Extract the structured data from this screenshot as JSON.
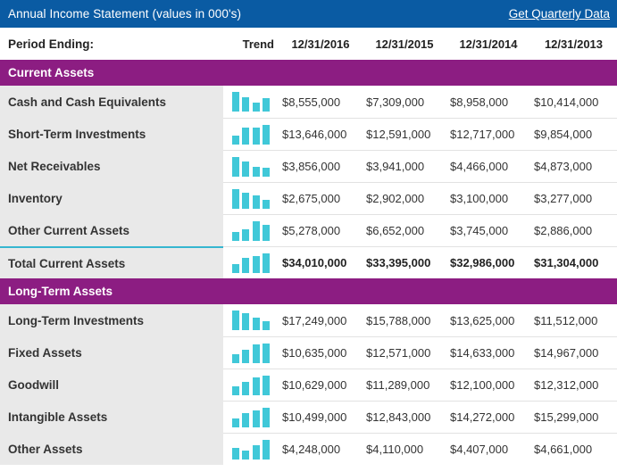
{
  "header": {
    "title": "Annual Income Statement (values in 000's)",
    "link_label": "Get Quarterly Data",
    "bar_color": "#0a5ba3"
  },
  "columns": {
    "period_label": "Period Ending:",
    "trend_label": "Trend",
    "dates": [
      "12/31/2016",
      "12/31/2015",
      "12/31/2014",
      "12/31/2013"
    ]
  },
  "colors": {
    "section_header": "#8c1d82",
    "sparkline_bar": "#40c8d8",
    "total_rule": "#36b6d0",
    "label_column": "#e9e9e9"
  },
  "sections": [
    {
      "title": "Current Assets",
      "rows": [
        {
          "label": "Cash and Cash Equivalents",
          "values": [
            "$8,555,000",
            "$7,309,000",
            "$8,958,000",
            "$10,414,000"
          ],
          "trend": [
            10414,
            8958,
            7309,
            8555
          ],
          "total": false
        },
        {
          "label": "Short-Term Investments",
          "values": [
            "$13,646,000",
            "$12,591,000",
            "$12,717,000",
            "$9,854,000"
          ],
          "trend": [
            9854,
            12717,
            12591,
            13646
          ],
          "total": false
        },
        {
          "label": "Net Receivables",
          "values": [
            "$3,856,000",
            "$3,941,000",
            "$4,466,000",
            "$4,873,000"
          ],
          "trend": [
            4873,
            4466,
            3941,
            3856
          ],
          "total": false
        },
        {
          "label": "Inventory",
          "values": [
            "$2,675,000",
            "$2,902,000",
            "$3,100,000",
            "$3,277,000"
          ],
          "trend": [
            3277,
            3100,
            2902,
            2675
          ],
          "total": false
        },
        {
          "label": "Other Current Assets",
          "values": [
            "$5,278,000",
            "$6,652,000",
            "$3,745,000",
            "$2,886,000"
          ],
          "trend": [
            2886,
            3745,
            6652,
            5278
          ],
          "total": false
        },
        {
          "label": "Total Current Assets",
          "values": [
            "$34,010,000",
            "$33,395,000",
            "$32,986,000",
            "$31,304,000"
          ],
          "trend": [
            31304,
            32986,
            33395,
            34010
          ],
          "total": true
        }
      ]
    },
    {
      "title": "Long-Term Assets",
      "rows": [
        {
          "label": "Long-Term Investments",
          "values": [
            "$17,249,000",
            "$15,788,000",
            "$13,625,000",
            "$11,512,000"
          ],
          "trend": [
            17249,
            15788,
            13625,
            11512
          ],
          "total": false
        },
        {
          "label": "Fixed Assets",
          "values": [
            "$10,635,000",
            "$12,571,000",
            "$14,633,000",
            "$14,967,000"
          ],
          "trend": [
            10635,
            12571,
            14633,
            14967
          ],
          "total": false
        },
        {
          "label": "Goodwill",
          "values": [
            "$10,629,000",
            "$11,289,000",
            "$12,100,000",
            "$12,312,000"
          ],
          "trend": [
            10629,
            11289,
            12100,
            12312
          ],
          "total": false
        },
        {
          "label": "Intangible Assets",
          "values": [
            "$10,499,000",
            "$12,843,000",
            "$14,272,000",
            "$15,299,000"
          ],
          "trend": [
            10499,
            12843,
            14272,
            15299
          ],
          "total": false
        },
        {
          "label": "Other Assets",
          "values": [
            "$4,248,000",
            "$4,110,000",
            "$4,407,000",
            "$4,661,000"
          ],
          "trend": [
            4248,
            4110,
            4407,
            4661
          ],
          "total": false
        }
      ]
    }
  ],
  "chart_data": {
    "type": "table",
    "title": "Annual Income Statement (values in 000's)",
    "categories": [
      "12/31/2016",
      "12/31/2015",
      "12/31/2014",
      "12/31/2013"
    ],
    "series": [
      {
        "name": "Cash and Cash Equivalents",
        "values": [
          8555000,
          7309000,
          8958000,
          10414000
        ]
      },
      {
        "name": "Short-Term Investments",
        "values": [
          13646000,
          12591000,
          12717000,
          9854000
        ]
      },
      {
        "name": "Net Receivables",
        "values": [
          3856000,
          3941000,
          4466000,
          4873000
        ]
      },
      {
        "name": "Inventory",
        "values": [
          2675000,
          2902000,
          3100000,
          3277000
        ]
      },
      {
        "name": "Other Current Assets",
        "values": [
          5278000,
          6652000,
          3745000,
          2886000
        ]
      },
      {
        "name": "Total Current Assets",
        "values": [
          34010000,
          33395000,
          32986000,
          31304000
        ]
      },
      {
        "name": "Long-Term Investments",
        "values": [
          17249000,
          15788000,
          13625000,
          11512000
        ]
      },
      {
        "name": "Fixed Assets",
        "values": [
          10635000,
          12571000,
          14633000,
          14967000
        ]
      },
      {
        "name": "Goodwill",
        "values": [
          10629000,
          11289000,
          12100000,
          12312000
        ]
      },
      {
        "name": "Intangible Assets",
        "values": [
          10499000,
          12843000,
          14272000,
          15299000
        ]
      },
      {
        "name": "Other Assets",
        "values": [
          4248000,
          4110000,
          4407000,
          4661000
        ]
      }
    ]
  }
}
